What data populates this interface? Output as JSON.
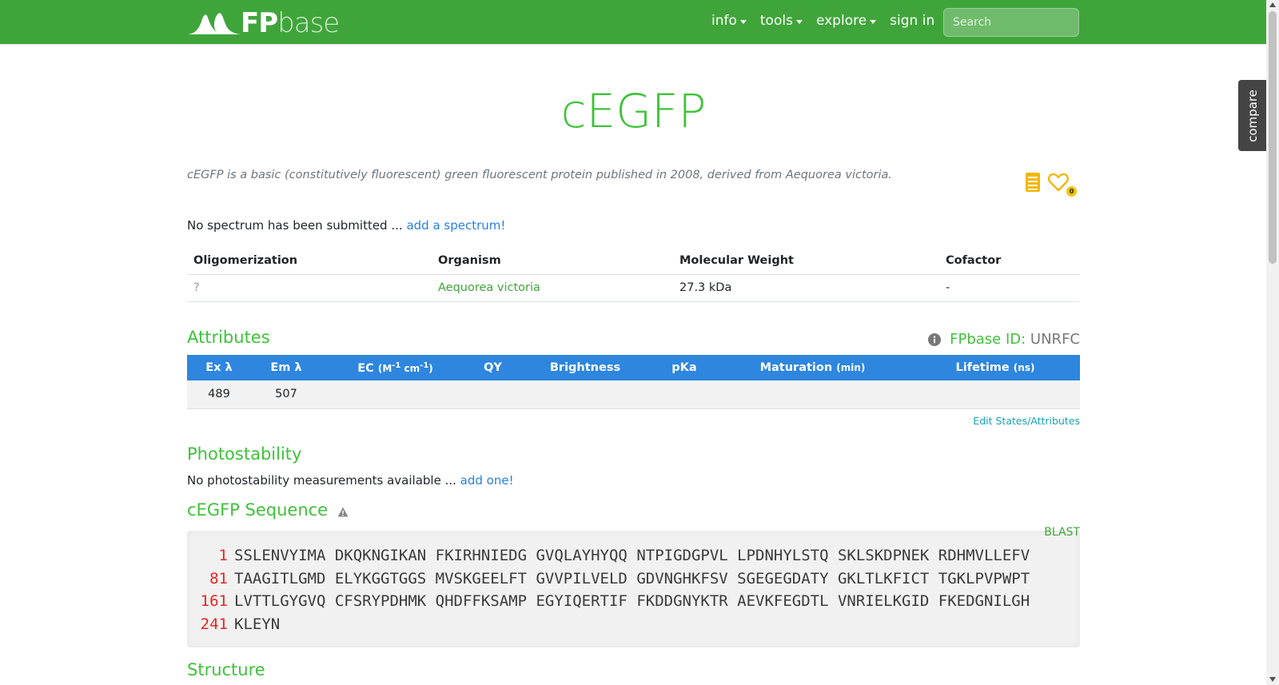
{
  "nav": {
    "brand_fp": "FP",
    "brand_base": "base",
    "links": [
      {
        "label": "info",
        "dropdown": true
      },
      {
        "label": "tools",
        "dropdown": true
      },
      {
        "label": "explore",
        "dropdown": true
      },
      {
        "label": "sign in",
        "dropdown": false
      }
    ],
    "search_placeholder": "Search"
  },
  "compare_tab": "compare",
  "protein": {
    "name": "cEGFP",
    "description": "cEGFP is a basic (constitutively fluorescent) green fluorescent protein published in 2008, derived from Aequorea victoria.",
    "favorites_count": "0"
  },
  "spectrum": {
    "text": "No spectrum has been submitted ...",
    "link": "add a spectrum!"
  },
  "info_table": {
    "headers": [
      "Oligomerization",
      "Organism",
      "Molecular Weight",
      "Cofactor"
    ],
    "values": [
      "?",
      "Aequorea victoria",
      "27.3 kDa",
      "-"
    ]
  },
  "attributes": {
    "title": "Attributes",
    "fpbase_id_label": "FPbase ID:",
    "fpbase_id": "UNRFC",
    "headers": {
      "ex": "Ex λ",
      "em": "Em λ",
      "ec": "EC",
      "ec_unit_pre": "(M",
      "ec_unit_sup1": "-1",
      "ec_unit_mid": " cm",
      "ec_unit_sup2": "-1",
      "ec_unit_post": ")",
      "qy": "QY",
      "brightness": "Brightness",
      "pka": "pKa",
      "maturation": "Maturation",
      "maturation_unit": "(min)",
      "lifetime": "Lifetime",
      "lifetime_unit": "(ns)"
    },
    "values": {
      "ex": "489",
      "em": "507",
      "ec": "",
      "qy": "",
      "brightness": "",
      "pka": "",
      "maturation": "",
      "lifetime": ""
    },
    "edit_link": "Edit States/Attributes"
  },
  "photostability": {
    "title": "Photostability",
    "text": "No photostability measurements available ...",
    "link": "add one!"
  },
  "sequence": {
    "title": "cEGFP Sequence",
    "blast": "BLAST",
    "rows": [
      {
        "num": "1",
        "seq": "SSLENVYIMA DKQKNGIKAN FKIRHNIEDG GVQLAYHYQQ NTPIGDGPVL LPDNHYLSTQ SKLSKDPNEK RDHMVLLEFV"
      },
      {
        "num": "81",
        "seq": "TAAGITLGMD ELYKGGTGGS MVSKGEELFT GVVPILVELD GDVNGHKFSV SGEGEGDATY GKLTLKFICT TGKLPVPWPT"
      },
      {
        "num": "161",
        "seq": "LVTTLGYGVQ CFSRYPDHMK QHDFFKSAMP EGYIQERTIF FKDDGNYKTR AEVKFEGDTL VNRIELKGID FKEDGNILGH"
      },
      {
        "num": "241",
        "seq": "KLEYN"
      }
    ]
  },
  "structure": {
    "title": "Structure"
  },
  "colors": {
    "navbar": "#3fa53a",
    "title_green": "#3fc23a",
    "table_header_blue": "#2e86de",
    "seq_num_red": "#e6261f"
  },
  "icons": [
    "brand-logo-icon",
    "book-icon",
    "heart-icon",
    "info-circle-icon",
    "warning-triangle-icon"
  ]
}
